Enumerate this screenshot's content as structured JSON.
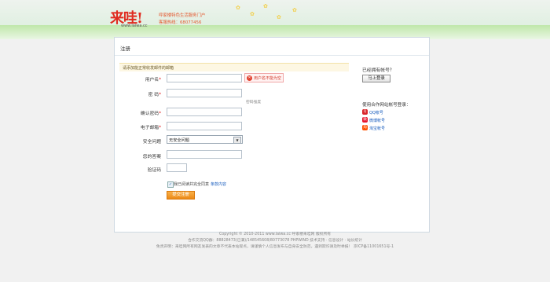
{
  "header": {
    "logo": "来哇!",
    "logo_site": "www.laiwa.cc",
    "tagline": "呼家楼特色生活服务门户",
    "hotline": "客服热线：68077456"
  },
  "panel": {
    "title": "注册",
    "notice": "请添加能正常收发邮件的邮箱"
  },
  "form": {
    "username_label": "用户名",
    "username_error": "用户名不能为空",
    "password_label": "密  码",
    "password_strength": "密码强度",
    "confirm_label": "确认密码",
    "email_label": "电子邮箱",
    "question_label": "安全问题",
    "question_value": "无安全问题",
    "answer_label": "您的答案",
    "captcha_label": "验证码",
    "required_mark": "*",
    "agree_text": "我已阅读并完全同意",
    "agree_link": "条款内容",
    "submit_label": "提交注册"
  },
  "sidebar": {
    "have_account": "已经拥有帐号？",
    "login_button": "马上登录",
    "partners_title": "使用合作网站帐号登录：",
    "partners": [
      {
        "label": "QQ帐号",
        "icon": "qq-icon",
        "color": "#d9262b",
        "glyph": "Q"
      },
      {
        "label": "微博帐号",
        "icon": "weibo-icon",
        "color": "#e6162d",
        "glyph": "微"
      },
      {
        "label": "淘宝帐号",
        "icon": "taobao-icon",
        "color": "#ff5000",
        "glyph": "淘"
      }
    ]
  },
  "footer": {
    "line1": "Copyright © 2010-2011 www.laiwa.cc 呼家楼来哇网 版权所有",
    "line2": "合作交流QQ群：88828473(已满)/148545608/80773078 PHPWIND 技术支持 · 信息设计 · 站长统计",
    "line3": "免责声明：来哇网所有网友发表的文章不代表本站观点，请谨慎个人信息发布与自身安全防范，遇到欺诈请及时举报！ 京ICP备11001651号-1"
  },
  "colors": {
    "brand_red": "#e02b20",
    "accent_orange": "#ec8a16",
    "link_blue": "#1b5fbf"
  }
}
